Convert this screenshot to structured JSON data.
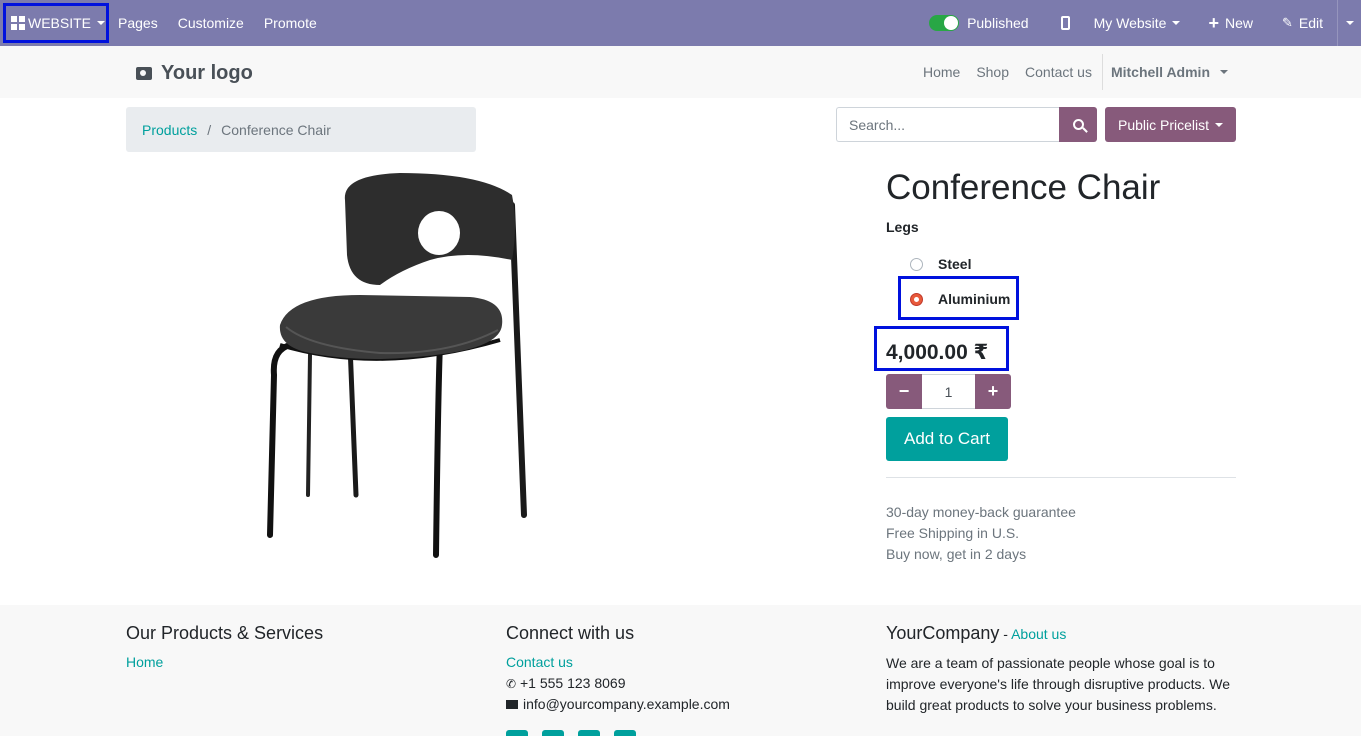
{
  "topbar": {
    "website_label": "WEBSITE",
    "menu": [
      "Pages",
      "Customize",
      "Promote"
    ],
    "published_label": "Published",
    "site_selector": "My Website",
    "new_label": "New",
    "edit_label": "Edit"
  },
  "header": {
    "logo_text": "Your logo",
    "nav": [
      "Home",
      "Shop",
      "Contact us"
    ],
    "user": "Mitchell Admin"
  },
  "breadcrumb": {
    "parent": "Products",
    "separator": "/",
    "current": "Conference Chair"
  },
  "search": {
    "placeholder": "Search..."
  },
  "pricelist_label": "Public Pricelist",
  "product": {
    "title": "Conference Chair",
    "attribute_label": "Legs",
    "options": [
      {
        "label": "Steel",
        "selected": false
      },
      {
        "label": "Aluminium",
        "selected": true
      }
    ],
    "price": "4,000.00 ₹",
    "quantity": "1",
    "add_to_cart": "Add to Cart",
    "perks": [
      "30-day money-back guarantee",
      "Free Shipping in U.S.",
      "Buy now, get in 2 days"
    ]
  },
  "footer": {
    "col1_title": "Our Products & Services",
    "col1_link": "Home",
    "col2_title": "Connect with us",
    "col2_link": "Contact us",
    "phone": "+1 555 123 8069",
    "email": "info@yourcompany.example.com",
    "col3_title": "YourCompany",
    "col3_sep": " - ",
    "col3_link": "About us",
    "col3_text": "We are a team of passionate people whose goal is to improve everyone's life through disruptive products. We build great products to solve your business problems."
  },
  "colors": {
    "admin_bar": "#7c7bad",
    "primary": "#875a7b",
    "accent": "#00a09d",
    "highlight": "#0011dd"
  }
}
